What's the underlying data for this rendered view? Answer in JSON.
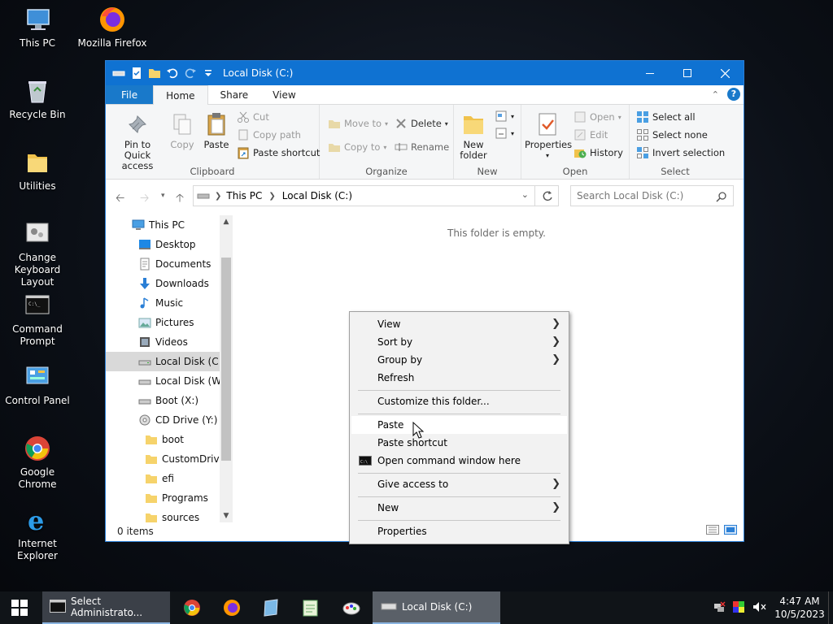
{
  "desktop": {
    "icons": [
      {
        "label": "This PC"
      },
      {
        "label": "Mozilla Firefox"
      },
      {
        "label": "Recycle Bin"
      },
      {
        "label": "Utilities"
      },
      {
        "label": "Change Keyboard Layout"
      },
      {
        "label": "Command Prompt"
      },
      {
        "label": "Control Panel"
      },
      {
        "label": "Google Chrome"
      },
      {
        "label": "Internet Explorer"
      }
    ]
  },
  "window": {
    "title": "Local Disk (C:)",
    "tabs": [
      "File",
      "Home",
      "Share",
      "View"
    ],
    "ribbon": {
      "clipboard": {
        "pin": "Pin to Quick access",
        "copy": "Copy",
        "paste": "Paste",
        "cut": "Cut",
        "copy_path": "Copy path",
        "paste_shortcut": "Paste shortcut",
        "label": "Clipboard"
      },
      "organize": {
        "move_to": "Move to",
        "copy_to": "Copy to",
        "delete": "Delete",
        "rename": "Rename",
        "label": "Organize"
      },
      "new": {
        "new_folder": "New folder",
        "label": "New"
      },
      "open": {
        "properties": "Properties",
        "open": "Open",
        "edit": "Edit",
        "history": "History",
        "label": "Open"
      },
      "select": {
        "select_all": "Select all",
        "select_none": "Select none",
        "invert": "Invert selection",
        "label": "Select"
      }
    },
    "address": {
      "crumbs": [
        "This PC",
        "Local Disk (C:)"
      ],
      "search_placeholder": "Search Local Disk (C:)"
    },
    "nav": {
      "items": [
        {
          "label": "This PC",
          "icon": "pc-icon"
        },
        {
          "label": "Desktop",
          "icon": "desktop-icon"
        },
        {
          "label": "Documents",
          "icon": "documents-icon"
        },
        {
          "label": "Downloads",
          "icon": "downloads-icon"
        },
        {
          "label": "Music",
          "icon": "music-icon"
        },
        {
          "label": "Pictures",
          "icon": "pictures-icon"
        },
        {
          "label": "Videos",
          "icon": "videos-icon"
        },
        {
          "label": "Local Disk (C:)",
          "icon": "drive-icon",
          "selected": true
        },
        {
          "label": "Local Disk (W:)",
          "icon": "drive-icon"
        },
        {
          "label": "Boot (X:)",
          "icon": "drive-icon"
        },
        {
          "label": "CD Drive (Y:) H",
          "icon": "cd-drive-icon"
        },
        {
          "label": "boot",
          "icon": "folder-icon"
        },
        {
          "label": "CustomDrive",
          "icon": "folder-icon"
        },
        {
          "label": "efi",
          "icon": "folder-icon"
        },
        {
          "label": "Programs",
          "icon": "folder-icon"
        },
        {
          "label": "sources",
          "icon": "folder-icon"
        }
      ]
    },
    "empty_text": "This folder is empty.",
    "status": "0 items"
  },
  "context_menu": {
    "items": [
      {
        "label": "View",
        "submenu": true
      },
      {
        "label": "Sort by",
        "submenu": true
      },
      {
        "label": "Group by",
        "submenu": true
      },
      {
        "label": "Refresh"
      },
      {
        "label": "Customize this folder..."
      },
      {
        "label": "Paste"
      },
      {
        "label": "Paste shortcut"
      },
      {
        "label": "Open command window here"
      },
      {
        "label": "Give access to",
        "submenu": true
      },
      {
        "label": "New",
        "submenu": true
      },
      {
        "label": "Properties"
      }
    ]
  },
  "taskbar": {
    "tasks": [
      {
        "label": "Select Administrato..."
      },
      {
        "label": "Local Disk (C:)"
      }
    ],
    "clock": {
      "time": "4:47 AM",
      "date": "10/5/2023"
    }
  },
  "colors": {
    "title_blue": "#0f72d2",
    "file_tab": "#1979ca",
    "taskbar": "#101418"
  }
}
